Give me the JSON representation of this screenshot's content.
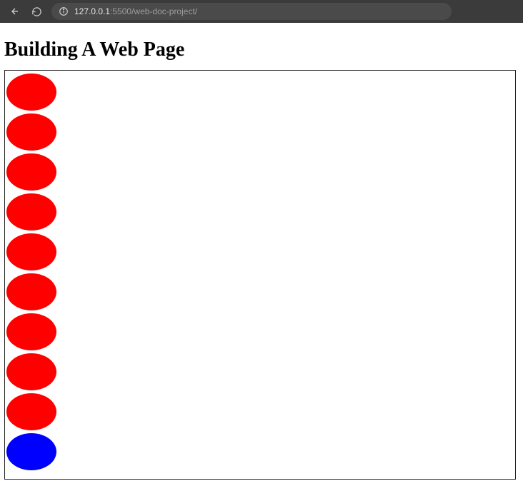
{
  "browser": {
    "url_host": "127.0.0.1",
    "url_port_path": ":5500/web-doc-project/"
  },
  "page": {
    "heading": "Building A Web Page"
  },
  "canvas": {
    "shapes": [
      {
        "color": "red"
      },
      {
        "color": "red"
      },
      {
        "color": "red"
      },
      {
        "color": "red"
      },
      {
        "color": "red"
      },
      {
        "color": "red"
      },
      {
        "color": "red"
      },
      {
        "color": "red"
      },
      {
        "color": "red"
      },
      {
        "color": "blue"
      }
    ],
    "colors": {
      "red": "#ff0000",
      "blue": "#0000ff"
    }
  }
}
